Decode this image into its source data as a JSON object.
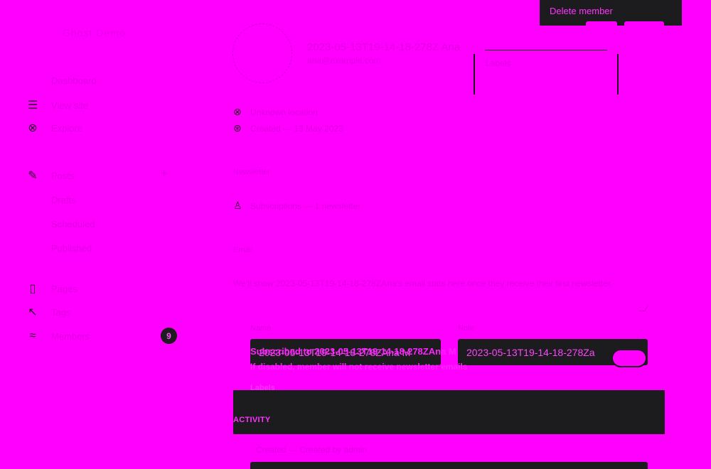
{
  "sidebar": {
    "title": "Ghost Demo",
    "items": [
      {
        "label": "Dashboard",
        "icon": "none"
      },
      {
        "label": "View site",
        "icon": "list-icon"
      },
      {
        "label": "Explore",
        "icon": "globe-icon"
      },
      {
        "label": "Posts",
        "icon": "pen-icon"
      },
      {
        "label": "Drafts",
        "icon": "none"
      },
      {
        "label": "Scheduled",
        "icon": "none"
      },
      {
        "label": "Published",
        "icon": "none"
      },
      {
        "label": "Pages",
        "icon": "page-icon"
      },
      {
        "label": "Tags",
        "icon": "tag-icon"
      },
      {
        "label": "Members",
        "icon": "members-icon"
      }
    ],
    "add_icon": "+",
    "members_badge": "9"
  },
  "menu": {
    "delete_label": "Delete member"
  },
  "member": {
    "name": "2023-05-13T19-14-18-278Z Ana",
    "email": "ana@example.com",
    "labels_text": "Labels",
    "location": "Unknown location",
    "created": "Created — 13 May 2023",
    "newsletter_label": "Newsletter",
    "subscriptions": "Subscriptions — 1 newsletter",
    "email_stats_label": "Email",
    "note": "We'll show 2023-05-13T19-14-18-278ZAna's email stats here once they receive their first newsletter."
  },
  "fields": {
    "name_label": "Name",
    "email_label": "Note",
    "name_value": "2023-05-13T19-14-18-278ZAna M",
    "email_value": "2023-05-13T19-14-18-278Za",
    "overlay_text": "Subscribed to 2023-05-13T19-14-18-278ZAna M",
    "hint_text": "If disabled, member will not receive newsletter emails"
  },
  "activity": {
    "top_label": "Labels",
    "title": "ACTIVITY",
    "line": "Created — Created by admin"
  },
  "colors": {
    "background": "#ff00ff",
    "panel": "#1c1c1e",
    "accent_text": "#ff33ff"
  }
}
